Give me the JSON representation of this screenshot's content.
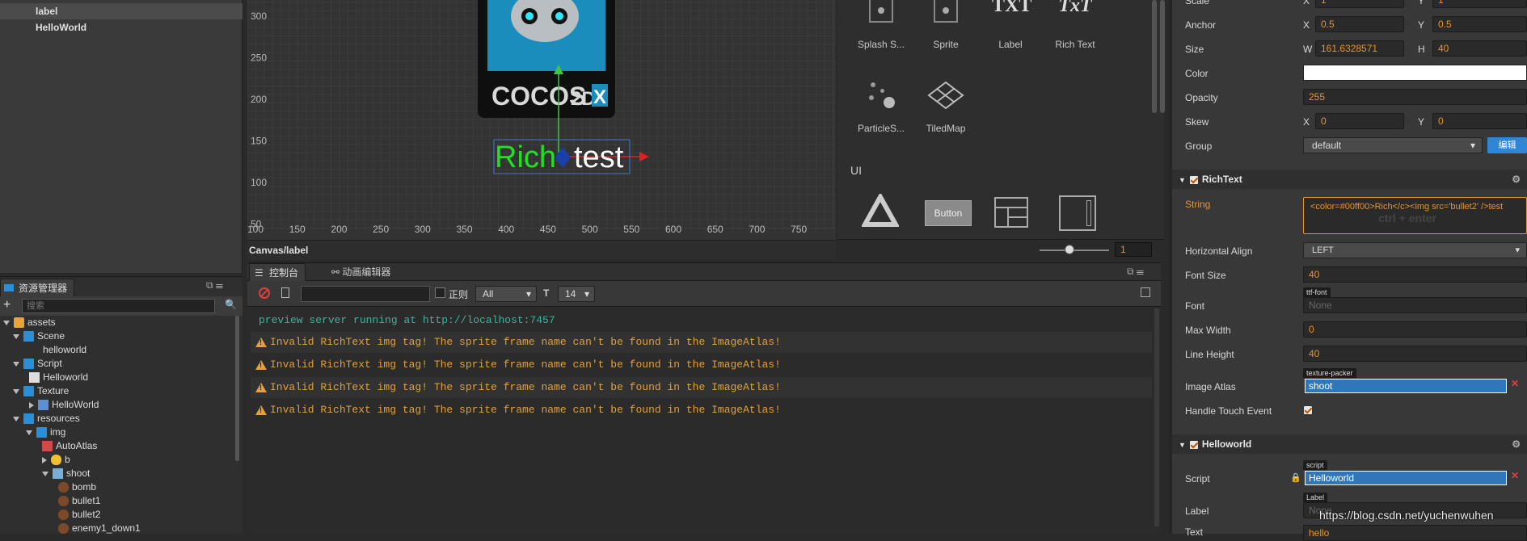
{
  "hierarchy": {
    "items": [
      {
        "label": "label",
        "selected": true
      },
      {
        "label": "HelloWorld",
        "selected": false
      }
    ]
  },
  "scene": {
    "status": "Canvas/label",
    "y_ticks": [
      "300",
      "250",
      "200",
      "150",
      "100",
      "50"
    ],
    "x_ticks": [
      "100",
      "150",
      "200",
      "250",
      "300",
      "350",
      "400",
      "450",
      "500",
      "550",
      "600",
      "650",
      "700",
      "750"
    ],
    "logo_text": "COCOS",
    "logo_suffix": "2D",
    "logo_x": "X",
    "rich_green": "Rich",
    "rich_white": "test"
  },
  "node_library": {
    "items": [
      "Splash S...",
      "Sprite",
      "Label",
      "Rich Text",
      "ParticleS...",
      "TiledMap"
    ],
    "label_glyph": "TXT",
    "rich_glyph": "TxT",
    "ui_section": "UI",
    "button_label": "Button",
    "zoom_value": "1"
  },
  "assets": {
    "tab": "资源管理器",
    "search_placeholder": "搜索",
    "tree": [
      {
        "label": "assets",
        "icon": "assets-icon",
        "expanded": true
      },
      {
        "label": "Scene",
        "icon": "folder-icon",
        "expanded": true
      },
      {
        "label": "helloworld",
        "icon": "scene-icon"
      },
      {
        "label": "Script",
        "icon": "folder-icon",
        "expanded": true
      },
      {
        "label": "Helloworld",
        "icon": "ts-icon"
      },
      {
        "label": "Texture",
        "icon": "folder-icon",
        "expanded": true
      },
      {
        "label": "HelloWorld",
        "icon": "texture-icon",
        "expanded": false
      },
      {
        "label": "resources",
        "icon": "folder-icon",
        "expanded": true
      },
      {
        "label": "img",
        "icon": "folder-icon",
        "expanded": true
      },
      {
        "label": "AutoAtlas",
        "icon": "autoatlas-icon"
      },
      {
        "label": "b",
        "icon": "image-icon",
        "expanded": false
      },
      {
        "label": "shoot",
        "icon": "atlas-icon",
        "expanded": true
      },
      {
        "label": "bomb",
        "icon": "sprite-frame-icon"
      },
      {
        "label": "bullet1",
        "icon": "sprite-frame-icon"
      },
      {
        "label": "bullet2",
        "icon": "sprite-frame-icon"
      },
      {
        "label": "enemy1_down1",
        "icon": "sprite-frame-icon"
      }
    ]
  },
  "console": {
    "tabs": [
      "控制台",
      "动画编辑器"
    ],
    "regex_label": "正则",
    "filter_value": "All",
    "font_size": "14",
    "lines": [
      {
        "text": "preview server running at http://localhost:7457",
        "level": "info"
      },
      {
        "text": "Invalid RichText img tag! The sprite frame name can't be found in the ImageAtlas!",
        "level": "warn"
      },
      {
        "text": "Invalid RichText img tag! The sprite frame name can't be found in the ImageAtlas!",
        "level": "warn"
      },
      {
        "text": "Invalid RichText img tag! The sprite frame name can't be found in the ImageAtlas!",
        "level": "warn"
      },
      {
        "text": "Invalid RichText img tag! The sprite frame name can't be found in the ImageAtlas!",
        "level": "warn"
      }
    ]
  },
  "inspector": {
    "node": {
      "scale_label": "Scale",
      "scale_x": "1",
      "scale_y": "1",
      "anchor_label": "Anchor",
      "anchor_x": "0.5",
      "anchor_y": "0.5",
      "size_label": "Size",
      "size_w": "161.6328571",
      "size_h": "40",
      "color_label": "Color",
      "opacity_label": "Opacity",
      "opacity": "255",
      "skew_label": "Skew",
      "skew_x": "0",
      "skew_y": "0",
      "group_label": "Group",
      "group": "default",
      "group_edit": "编辑",
      "x": "X",
      "y": "Y",
      "w": "W",
      "h": "H"
    },
    "richtext": {
      "title": "RichText",
      "string_label": "String",
      "string_value": "<color=#00ff00>Rich</c><img src='bullet2' />test",
      "string_hint": "ctrl + enter",
      "halign_label": "Horizontal Align",
      "halign": "LEFT",
      "fontsize_label": "Font Size",
      "fontsize": "40",
      "font_label": "Font",
      "font_tag": "ttf-font",
      "font_value": "None",
      "maxwidth_label": "Max Width",
      "maxwidth": "0",
      "lineheight_label": "Line Height",
      "lineheight": "40",
      "atlas_label": "Image Atlas",
      "atlas_tag": "texture-packer",
      "atlas_value": "shoot",
      "touch_label": "Handle Touch Event"
    },
    "helloworld": {
      "title": "Helloworld",
      "script_label": "Script",
      "script_tag": "script",
      "script_value": "Helloworld",
      "label_label": "Label",
      "label_tag": "Label",
      "label_value": "None",
      "text_label": "Text",
      "text_value": "hello"
    }
  },
  "watermark": "https://blog.csdn.net/yuchenwuhen"
}
